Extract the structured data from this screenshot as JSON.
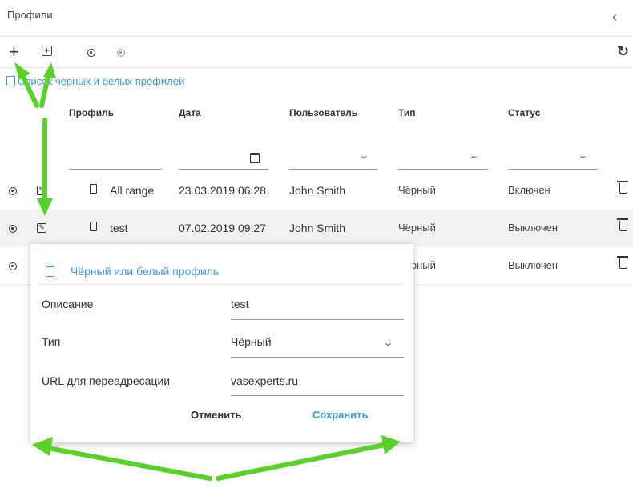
{
  "panel": {
    "title": "Профили",
    "collapse_glyph": "‹"
  },
  "toolbar": {
    "add_glyph": "+",
    "add_group_glyph": "+",
    "refresh_glyph": "↻"
  },
  "link": {
    "text": "Список черных и белых профилей"
  },
  "table": {
    "headers": [
      "Профиль",
      "Дата",
      "Пользователь",
      "Тип",
      "Статус"
    ],
    "rows": [
      {
        "profile": "All range",
        "date": "23.03.2019 06:28",
        "user": "John Smith",
        "type": "Чёрный",
        "status": "Включен"
      },
      {
        "profile": "test",
        "date": "07.02.2019 09:27",
        "user": "John Smith",
        "type": "Чёрный",
        "status": "Выключен"
      },
      {
        "profile": "",
        "date": "",
        "user": "",
        "type": "Чёрный",
        "status": "Выключен"
      }
    ]
  },
  "dialog": {
    "title": "Чёрный или белый профиль",
    "fields": [
      {
        "label": "Описание",
        "value": "test"
      },
      {
        "label": "Тип",
        "value": "Чёрный"
      },
      {
        "label": "URL для переадресации",
        "value": "vasexperts.ru"
      }
    ],
    "cancel": "Отменить",
    "save": "Сохранить"
  },
  "colors": {
    "accent": "#3f9be0",
    "arrow": "#5ad12a",
    "selected_row": "#f2f2f2"
  }
}
